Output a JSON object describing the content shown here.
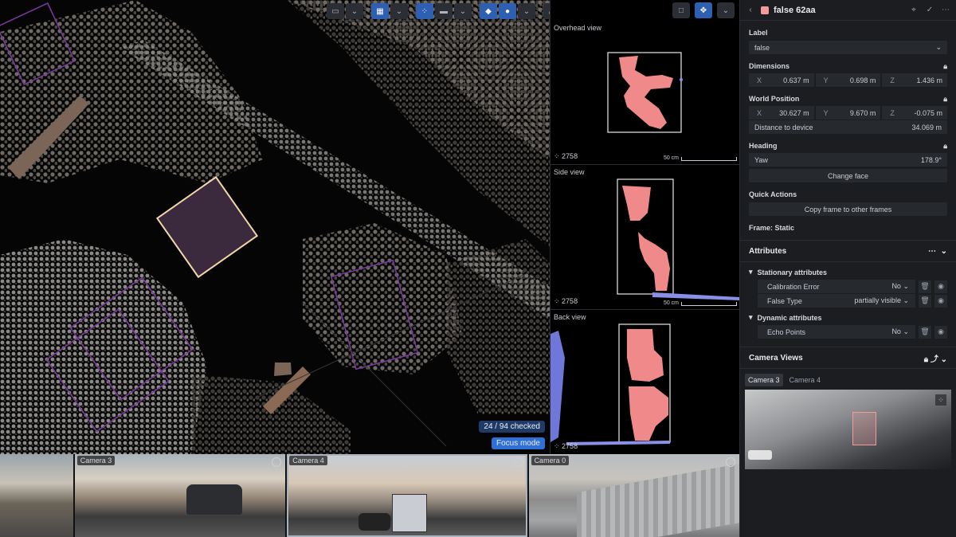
{
  "viewport": {
    "checked_text": "24 / 94 checked",
    "focus_label": "Focus mode"
  },
  "ortho": {
    "views": [
      {
        "title": "Overhead view",
        "count": "2758",
        "scale": "50 cm"
      },
      {
        "title": "Side view",
        "count": "2758",
        "scale": "50 cm"
      },
      {
        "title": "Back view",
        "count": "2758",
        "scale": ""
      }
    ]
  },
  "strip": {
    "cameras": [
      {
        "label": ""
      },
      {
        "label": "Camera 3"
      },
      {
        "label": "Camera 4"
      },
      {
        "label": "Camera 0"
      }
    ]
  },
  "panel": {
    "title": "false 62aa",
    "swatch_color": "#f29a9a",
    "label_heading": "Label",
    "label_value": "false",
    "dimensions_heading": "Dimensions",
    "dimensions": [
      {
        "axis": "X",
        "value": "0.637 m"
      },
      {
        "axis": "Y",
        "value": "0.698 m"
      },
      {
        "axis": "Z",
        "value": "1.436 m"
      }
    ],
    "world_heading": "World Position",
    "world": [
      {
        "axis": "X",
        "value": "30.627 m"
      },
      {
        "axis": "Y",
        "value": "9.670 m"
      },
      {
        "axis": "Z",
        "value": "-0.075 m"
      }
    ],
    "distance_label": "Distance to device",
    "distance_value": "34.069 m",
    "heading_heading": "Heading",
    "yaw_label": "Yaw",
    "yaw_value": "178.9°",
    "change_face": "Change face",
    "quick_actions_heading": "Quick Actions",
    "copy_frame": "Copy frame to other frames",
    "frame_static": "Frame: Static",
    "attributes_heading": "Attributes",
    "stationary_heading": "Stationary attributes",
    "stationary": [
      {
        "name": "Calibration Error",
        "value": "No"
      },
      {
        "name": "False Type",
        "value": "partially visible"
      }
    ],
    "dynamic_heading": "Dynamic attributes",
    "dynamic": [
      {
        "name": "Echo Points",
        "value": "No"
      }
    ],
    "camera_views_heading": "Camera Views",
    "camera_tabs": [
      "Camera 3",
      "Camera 4"
    ]
  },
  "colors": {
    "accent": "#2f6fd6",
    "annotation_box": "#7b3a9e",
    "selected_box": "#f3d6a8",
    "points_pink": "#f08a8a"
  }
}
